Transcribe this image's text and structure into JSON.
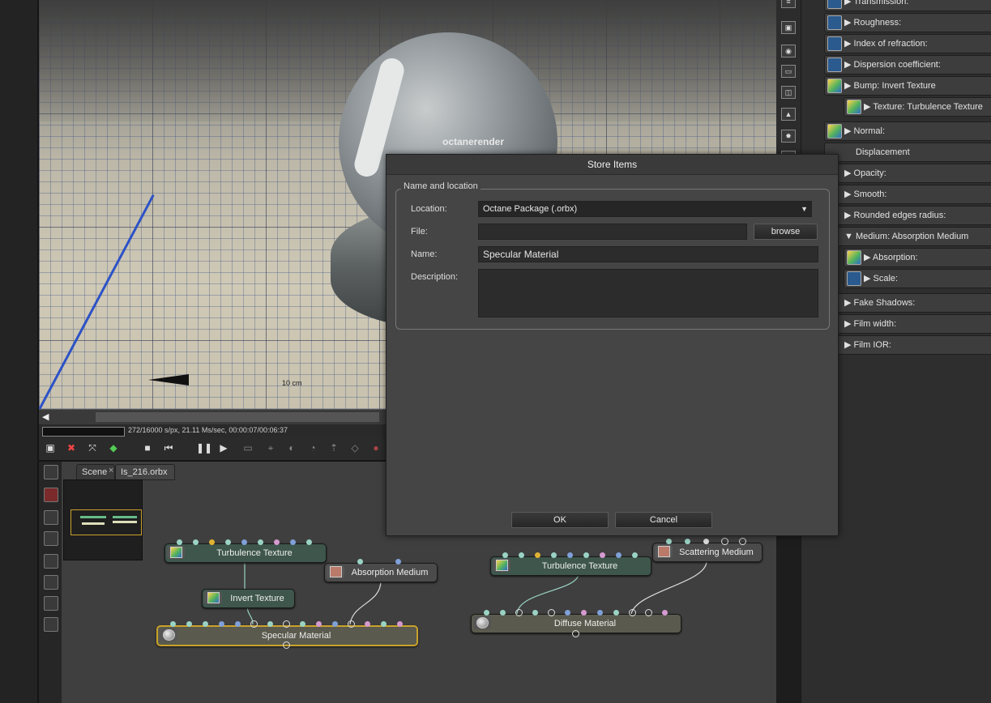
{
  "viewport": {
    "logo_text": "octanerender",
    "ruler_label": "10 cm"
  },
  "render_status": "272/16000 s/px, 21.11 Ms/sec, 00:00:07/00:06:37",
  "graph_editor": {
    "tabs": [
      "Scene",
      "Is_216.orbx"
    ],
    "nodes": {
      "turbulence_1": "Turbulence Texture",
      "invert_texture": "Invert Texture",
      "absorption_medium": "Absorption Medium",
      "specular_material": "Specular Material",
      "turbulence_2": "Turbulence Texture",
      "scattering_medium": "Scattering Medium",
      "diffuse_material": "Diffuse Material"
    }
  },
  "right_panel": {
    "rows": [
      {
        "label": "Transmission:"
      },
      {
        "label": "Roughness:"
      },
      {
        "label": "Index of refraction:"
      },
      {
        "label": "Dispersion coefficient:"
      },
      {
        "label": "Bump: Invert Texture"
      },
      {
        "label": "Texture: Turbulence Texture"
      },
      {
        "label": "Normal:"
      },
      {
        "label": "Displacement"
      },
      {
        "label": "Opacity:"
      },
      {
        "label": "Smooth:"
      },
      {
        "label": "Rounded edges radius:"
      },
      {
        "label": "Medium: Absorption Medium"
      },
      {
        "label": "Absorption:"
      },
      {
        "label": "Scale:"
      },
      {
        "label": "Fake Shadows:"
      },
      {
        "label": "Film width:"
      },
      {
        "label": "Film IOR:"
      }
    ]
  },
  "dialog": {
    "title": "Store Items",
    "group_title": "Name and location",
    "location_label": "Location:",
    "location_value": "Octane Package (.orbx)",
    "file_label": "File:",
    "file_value": "",
    "browse_label": "browse",
    "name_label": "Name:",
    "name_value": "Specular Material",
    "description_label": "Description:",
    "description_value": "",
    "ok_label": "OK",
    "cancel_label": "Cancel"
  },
  "colors": {
    "selection_outline": "#c9a22a",
    "texture_node": "#3e564c",
    "accent_blue_line": "#2c52c6"
  }
}
